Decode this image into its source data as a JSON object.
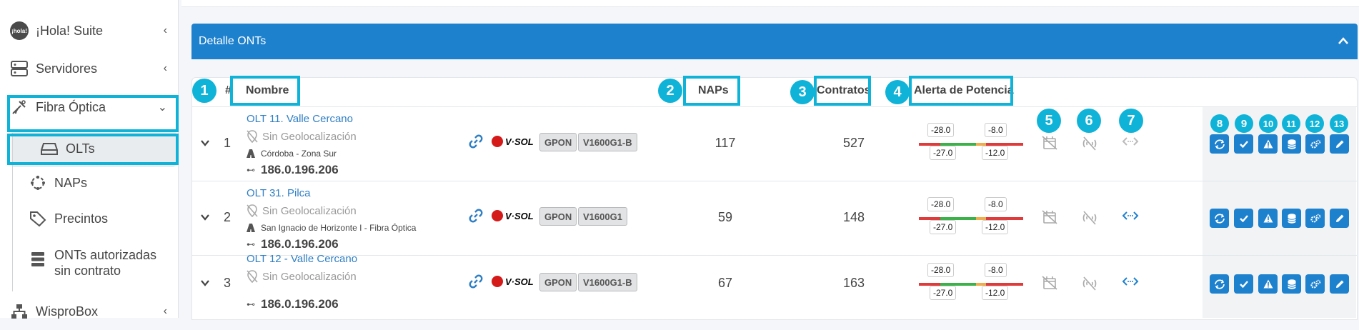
{
  "sidebar": {
    "items": [
      {
        "label": "¡Hola! Suite",
        "icon": "hola-icon"
      },
      {
        "label": "Servidores",
        "icon": "server-icon"
      },
      {
        "label": "Fibra Óptica",
        "icon": "fiber-icon"
      },
      {
        "label": "OLTs",
        "icon": "olt-icon"
      },
      {
        "label": "NAPs",
        "icon": "nap-icon"
      },
      {
        "label": "Precintos",
        "icon": "tag-icon"
      },
      {
        "label": "ONTs autorizadas sin contrato",
        "icon": "database-icon"
      },
      {
        "label": "WisproBox",
        "icon": "network-icon"
      }
    ],
    "hola_badge": "¡hola!"
  },
  "card": {
    "title": "Detalle ONTs"
  },
  "table": {
    "headers": {
      "index": "#",
      "name": "Nombre",
      "naps": "NAPs",
      "contracts": "Contratos",
      "power_alert": "Alerta de Potencia"
    },
    "rows": [
      {
        "index": "1",
        "name": "OLT 11. Valle Cercano",
        "geo": "Sin Geolocalización",
        "location": "Córdoba - Zona Sur",
        "ip": "186.0.196.206",
        "brand": "V·SOL",
        "tech": "GPON",
        "model": "V1600G1-B",
        "naps": "117",
        "contracts": "527",
        "power": {
          "min_low": "-28.0",
          "min_high": "-27.0",
          "max_low": "-12.0",
          "max_high": "-8.0"
        },
        "link_active": false
      },
      {
        "index": "2",
        "name": "OLT 31. Pilca",
        "geo": "Sin Geolocalización",
        "location": "San Ignacio de Horizonte I - Fibra Óptica",
        "ip": "186.0.196.206",
        "brand": "V·SOL",
        "tech": "GPON",
        "model": "V1600G1",
        "naps": "59",
        "contracts": "148",
        "power": {
          "min_low": "-28.0",
          "min_high": "-27.0",
          "max_low": "-12.0",
          "max_high": "-8.0"
        },
        "link_active": true
      },
      {
        "index": "3",
        "name": "OLT 12 - Valle Cercano",
        "geo": "Sin Geolocalización",
        "location": "",
        "ip": "186.0.196.206",
        "brand": "V·SOL",
        "tech": "GPON",
        "model": "V1600G1-B",
        "naps": "67",
        "contracts": "163",
        "power": {
          "min_low": "-28.0",
          "min_high": "-27.0",
          "max_low": "-12.0",
          "max_high": "-8.0"
        },
        "link_active": true
      }
    ]
  },
  "annotations": [
    "1",
    "2",
    "3",
    "4",
    "5",
    "6",
    "7",
    "8",
    "9",
    "10",
    "11",
    "12",
    "13"
  ],
  "colors": {
    "accent": "#10b3d8",
    "primary": "#1e81ce",
    "red": "#e03b3b",
    "green": "#3cb14a",
    "orange": "#f0ad4e"
  }
}
